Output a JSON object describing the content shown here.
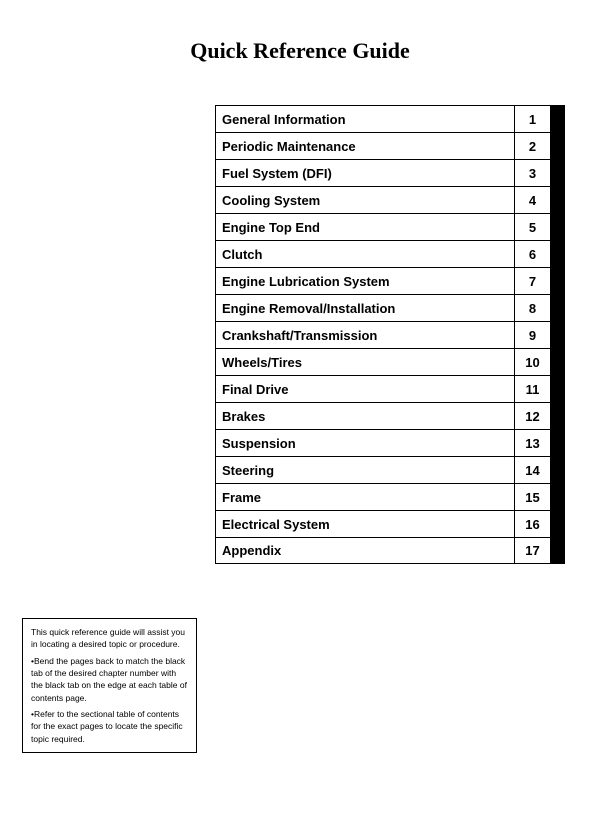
{
  "title": "Quick Reference Guide",
  "toc": {
    "items": [
      {
        "label": "General Information",
        "number": "1"
      },
      {
        "label": "Periodic Maintenance",
        "number": "2"
      },
      {
        "label": "Fuel System (DFI)",
        "number": "3"
      },
      {
        "label": "Cooling System",
        "number": "4"
      },
      {
        "label": "Engine Top End",
        "number": "5"
      },
      {
        "label": "Clutch",
        "number": "6"
      },
      {
        "label": "Engine Lubrication System",
        "number": "7"
      },
      {
        "label": "Engine Removal/Installation",
        "number": "8"
      },
      {
        "label": "Crankshaft/Transmission",
        "number": "9"
      },
      {
        "label": "Wheels/Tires",
        "number": "10"
      },
      {
        "label": "Final Drive",
        "number": "11"
      },
      {
        "label": "Brakes",
        "number": "12"
      },
      {
        "label": "Suspension",
        "number": "13"
      },
      {
        "label": "Steering",
        "number": "14"
      },
      {
        "label": "Frame",
        "number": "15"
      },
      {
        "label": "Electrical System",
        "number": "16"
      },
      {
        "label": "Appendix",
        "number": "17"
      }
    ]
  },
  "note": {
    "line1": "This quick reference guide will assist you in locating a desired topic or procedure.",
    "line2": "•Bend the pages back to match the black tab of the desired chapter number with the black tab on the edge at each table of contents page.",
    "line3": "•Refer to the sectional table of contents for the exact pages to locate the specific topic required."
  }
}
